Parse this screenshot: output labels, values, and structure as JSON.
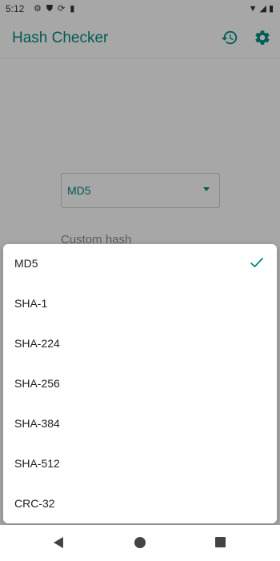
{
  "status_bar": {
    "time": "5:12",
    "left_icons": [
      "settings-icon",
      "shield-icon",
      "sync-icon",
      "sim-icon"
    ],
    "right_icons": [
      "wifi-icon",
      "signal-icon",
      "battery-icon"
    ]
  },
  "app_bar": {
    "title": "Hash Checker",
    "actions": [
      "history-icon",
      "settings-icon"
    ]
  },
  "main": {
    "selected_algorithm": "MD5",
    "custom_hash_label": "Custom hash"
  },
  "menu": {
    "selected": "MD5",
    "items": [
      {
        "label": "MD5",
        "checked": true
      },
      {
        "label": "SHA-1",
        "checked": false
      },
      {
        "label": "SHA-224",
        "checked": false
      },
      {
        "label": "SHA-256",
        "checked": false
      },
      {
        "label": "SHA-384",
        "checked": false
      },
      {
        "label": "SHA-512",
        "checked": false
      },
      {
        "label": "CRC-32",
        "checked": false
      }
    ]
  },
  "colors": {
    "accent": "#00897b",
    "text": "#212121",
    "scrim": "rgba(0,0,0,0.32)"
  },
  "nav_bar": {
    "buttons": [
      "back-icon",
      "home-icon",
      "recents-icon"
    ]
  }
}
